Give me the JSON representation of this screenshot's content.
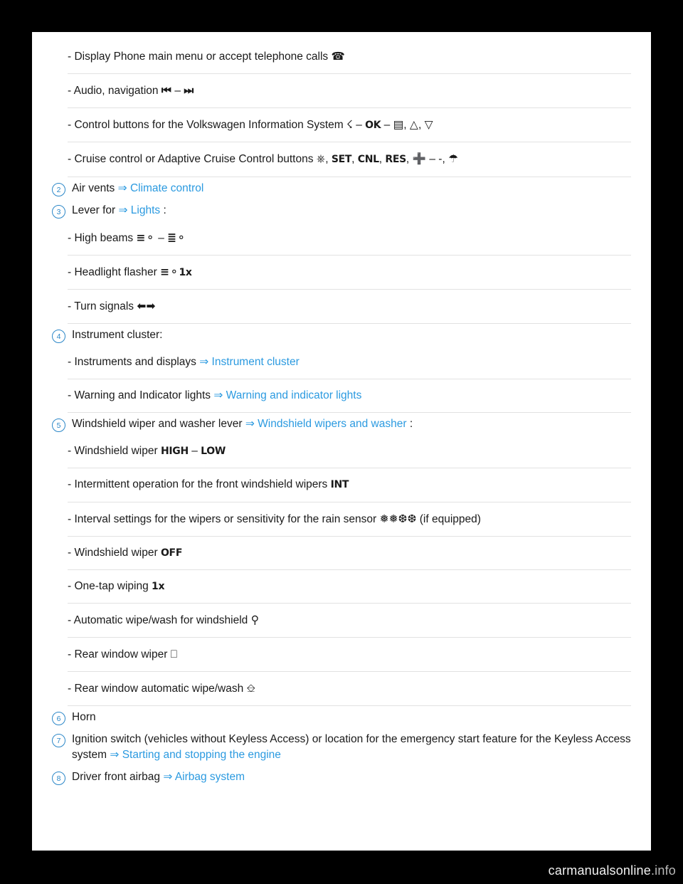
{
  "document": {
    "watermark_main": "carmanualsonline",
    "watermark_suffix": ".info"
  },
  "items": [
    {
      "kind": "sub",
      "text": "- Display Phone main menu or accept telephone calls",
      "symbols": "phone-handset"
    },
    {
      "kind": "sub",
      "text": "- Audio, navigation",
      "symbols": "skip-back – skip-forward"
    },
    {
      "kind": "sub",
      "text": "- Control buttons for the Volkswagen Information System",
      "symbols": "reset – OK – menu, up-triangle, down-triangle"
    },
    {
      "kind": "sub",
      "text": "- Cruise control or Adaptive Cruise Control buttons",
      "symbols": "0/1, SET, CNL, RES, + – -, distance"
    },
    {
      "kind": "num",
      "number": "2",
      "text": "Air vents",
      "link": "Climate control",
      "arrow": "⇒",
      "trailing": ""
    },
    {
      "kind": "num",
      "number": "3",
      "text": "Lever for",
      "link": "Lights",
      "arrow": "⇒",
      "trailing": ":"
    },
    {
      "kind": "sub",
      "text": "- High beams",
      "symbols": "high-beam – low-beam"
    },
    {
      "kind": "sub",
      "text": "- Headlight flasher",
      "symbols": "flasher 1x"
    },
    {
      "kind": "sub",
      "text": "- Turn signals",
      "symbols": "left-arrow right-arrow"
    },
    {
      "kind": "num",
      "number": "4",
      "text": "Instrument cluster:",
      "link": "",
      "arrow": "",
      "trailing": ""
    },
    {
      "kind": "sub",
      "text": "- Instruments and displays",
      "link": "Instrument cluster",
      "arrow": "⇒"
    },
    {
      "kind": "sub",
      "text": "- Warning and Indicator lights",
      "link": "Warning and indicator lights",
      "arrow": "⇒"
    },
    {
      "kind": "num",
      "number": "5",
      "text": "Windshield wiper and washer lever",
      "link": "Windshield wipers and washer",
      "arrow": "⇒",
      "trailing": ":"
    },
    {
      "kind": "sub",
      "text": "- Windshield wiper",
      "symbols": "HIGH – LOW"
    },
    {
      "kind": "sub",
      "text": "- Intermittent operation for the front windshield wipers",
      "symbols": "INT"
    },
    {
      "kind": "sub",
      "text": "- Interval settings for the wipers or sensitivity for the rain sensor",
      "symbols": "drops",
      "suffix": "(if equipped)"
    },
    {
      "kind": "sub",
      "text": "- Windshield wiper",
      "symbols": "OFF"
    },
    {
      "kind": "sub",
      "text": "- One-tap wiping",
      "symbols": "1x"
    },
    {
      "kind": "sub",
      "text": "- Automatic wipe/wash for windshield",
      "symbols": "wash-front"
    },
    {
      "kind": "sub",
      "text": "- Rear window wiper",
      "symbols": "rear-wiper"
    },
    {
      "kind": "sub",
      "text": "- Rear window automatic wipe/wash",
      "symbols": "rear-wash"
    },
    {
      "kind": "num",
      "number": "6",
      "text": "Horn",
      "link": "",
      "arrow": "",
      "trailing": ""
    },
    {
      "kind": "num",
      "number": "7",
      "text": "Ignition switch (vehicles without Keyless Access) or location for the emergency start feature for the Keyless Access system",
      "link": "Starting and stopping the engine",
      "arrow": "⇒",
      "trailing": ""
    },
    {
      "kind": "num",
      "number": "8",
      "text": "Driver front airbag",
      "link": "Airbag system",
      "arrow": "⇒",
      "trailing": ""
    }
  ],
  "labels": {
    "phone": "",
    "ok": "OK",
    "set": "SET",
    "cnl": "CNL",
    "res": "RES",
    "high": "HIGH",
    "low": "LOW",
    "int": "INT",
    "off": "OFF",
    "onetap": "1x",
    "flasher_1x": "1x",
    "zero_one": "0/1",
    "if_equipped": "(if equipped)"
  }
}
